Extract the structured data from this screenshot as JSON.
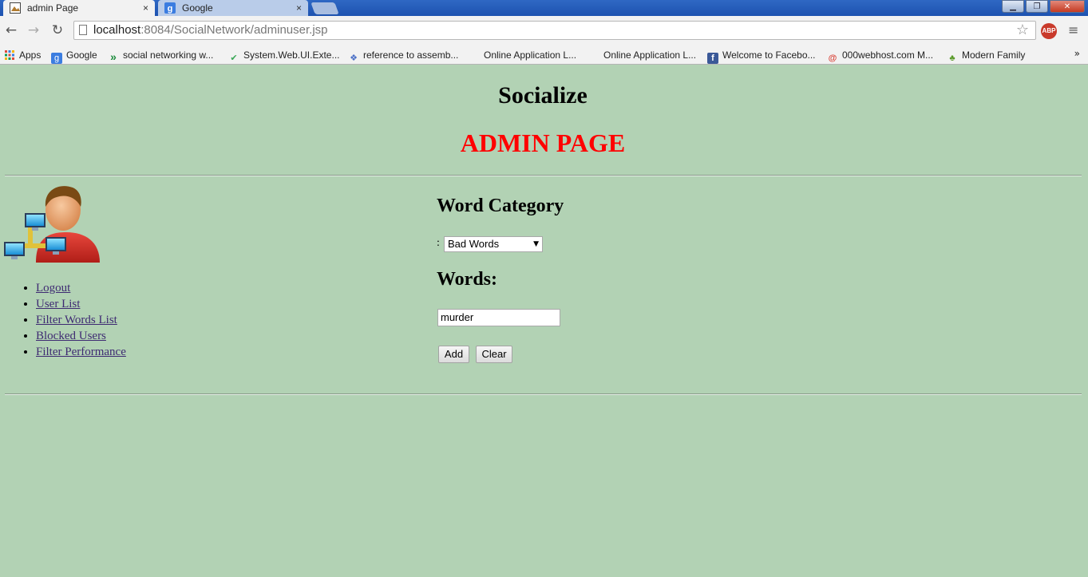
{
  "browser": {
    "tabs": [
      {
        "title": "admin Page",
        "close": "×"
      },
      {
        "title": "Google",
        "close": "×"
      }
    ],
    "window_buttons": {
      "minimize": "▁",
      "maximize": "❐",
      "close": "✕"
    },
    "nav": {
      "back": "←",
      "forward": "→",
      "reload": "↻",
      "star": "☆",
      "menu": "≡"
    },
    "url": {
      "host": "localhost",
      "path": ":8084/SocialNetwork/adminuser.jsp"
    },
    "abp_label": "ABP",
    "bookmarks": [
      {
        "label": "Apps",
        "icon": "apps-grid-icon"
      },
      {
        "label": "Google",
        "icon": "google-icon",
        "glyph": "g"
      },
      {
        "label": "social networking w...",
        "icon": "double-chevron-icon",
        "glyph": "»"
      },
      {
        "label": "System.Web.UI.Exte...",
        "icon": "checkmark-icon",
        "glyph": "✔"
      },
      {
        "label": "reference to assemb...",
        "icon": "dropbox-icon",
        "glyph": "❖"
      },
      {
        "label": "Online Application L...",
        "icon": "blank-icon",
        "glyph": ""
      },
      {
        "label": "Online Application L...",
        "icon": "blank-icon",
        "glyph": ""
      },
      {
        "label": "Welcome to Facebo...",
        "icon": "facebook-icon",
        "glyph": "f"
      },
      {
        "label": "000webhost.com M...",
        "icon": "webhost-icon",
        "glyph": "@"
      },
      {
        "label": "Modern Family",
        "icon": "tree-icon",
        "glyph": "♣"
      }
    ],
    "bookmarks_overflow": "»"
  },
  "page": {
    "site_title": "Socialize",
    "admin_title": "ADMIN PAGE",
    "nav_links": [
      "Logout",
      "User List",
      "Filter Words List",
      "Blocked Users",
      "Filter Performance"
    ],
    "word_category_heading": "Word Category",
    "category_colon": ":",
    "category_selected": "Bad Words",
    "words_heading": "Words:",
    "word_value": "murder",
    "add_button": "Add",
    "clear_button": "Clear"
  },
  "colors": {
    "page_bg": "#b2d2b4",
    "admin_title": "#ff0000",
    "link": "#3e2a72"
  }
}
